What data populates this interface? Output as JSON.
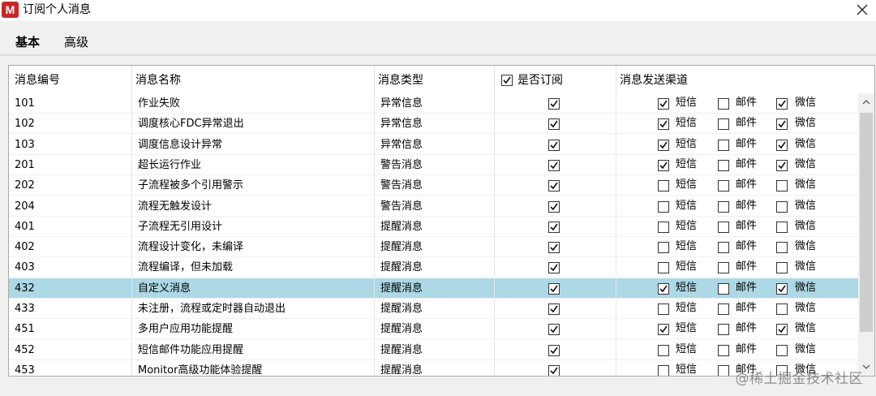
{
  "window": {
    "title": "订阅个人消息",
    "logo_letter": "M"
  },
  "tabs": [
    {
      "label": "基本",
      "active": true
    },
    {
      "label": "高级",
      "active": false
    }
  ],
  "columns": {
    "id": "消息编号",
    "name": "消息名称",
    "type": "消息类型",
    "subscribed": "是否订阅",
    "subscribed_all_checked": true,
    "channels": "消息发送渠道"
  },
  "channel_labels": {
    "sms": "短信",
    "mail": "邮件",
    "wechat": "微信"
  },
  "rows": [
    {
      "id": "101",
      "name": "作业失败",
      "type": "异常信息",
      "subscribed": true,
      "sms": true,
      "mail": false,
      "wechat": true,
      "selected": false
    },
    {
      "id": "102",
      "name": "调度核心FDC异常退出",
      "type": "异常信息",
      "subscribed": true,
      "sms": true,
      "mail": false,
      "wechat": true,
      "selected": false
    },
    {
      "id": "103",
      "name": "调度信息设计异常",
      "type": "异常信息",
      "subscribed": true,
      "sms": true,
      "mail": false,
      "wechat": true,
      "selected": false
    },
    {
      "id": "201",
      "name": "超长运行作业",
      "type": "警告消息",
      "subscribed": true,
      "sms": true,
      "mail": false,
      "wechat": true,
      "selected": false
    },
    {
      "id": "202",
      "name": "子流程被多个引用警示",
      "type": "警告消息",
      "subscribed": true,
      "sms": false,
      "mail": false,
      "wechat": false,
      "selected": false
    },
    {
      "id": "204",
      "name": "流程无触发设计",
      "type": "警告消息",
      "subscribed": true,
      "sms": false,
      "mail": false,
      "wechat": false,
      "selected": false
    },
    {
      "id": "401",
      "name": "子流程无引用设计",
      "type": "提醒消息",
      "subscribed": true,
      "sms": false,
      "mail": false,
      "wechat": false,
      "selected": false
    },
    {
      "id": "402",
      "name": "流程设计变化，未编译",
      "type": "提醒消息",
      "subscribed": true,
      "sms": false,
      "mail": false,
      "wechat": false,
      "selected": false
    },
    {
      "id": "403",
      "name": "流程编译，但未加载",
      "type": "提醒消息",
      "subscribed": true,
      "sms": false,
      "mail": false,
      "wechat": false,
      "selected": false
    },
    {
      "id": "432",
      "name": "自定义消息",
      "type": "提醒消息",
      "subscribed": true,
      "sms": true,
      "mail": false,
      "wechat": true,
      "selected": true
    },
    {
      "id": "433",
      "name": "未注册，流程或定时器自动退出",
      "type": "提醒消息",
      "subscribed": true,
      "sms": false,
      "mail": false,
      "wechat": false,
      "selected": false
    },
    {
      "id": "451",
      "name": "多用户应用功能提醒",
      "type": "提醒消息",
      "subscribed": true,
      "sms": true,
      "mail": false,
      "wechat": true,
      "selected": false
    },
    {
      "id": "452",
      "name": "短信邮件功能应用提醒",
      "type": "提醒消息",
      "subscribed": true,
      "sms": false,
      "mail": false,
      "wechat": false,
      "selected": false
    },
    {
      "id": "453",
      "name": "Monitor高级功能体验提醒",
      "type": "提醒消息",
      "subscribed": true,
      "sms": false,
      "mail": false,
      "wechat": false,
      "selected": false
    }
  ],
  "watermark": "@稀土掘金技术社区",
  "colors": {
    "selected_row": "#add8e6",
    "logo": "#c62828"
  }
}
